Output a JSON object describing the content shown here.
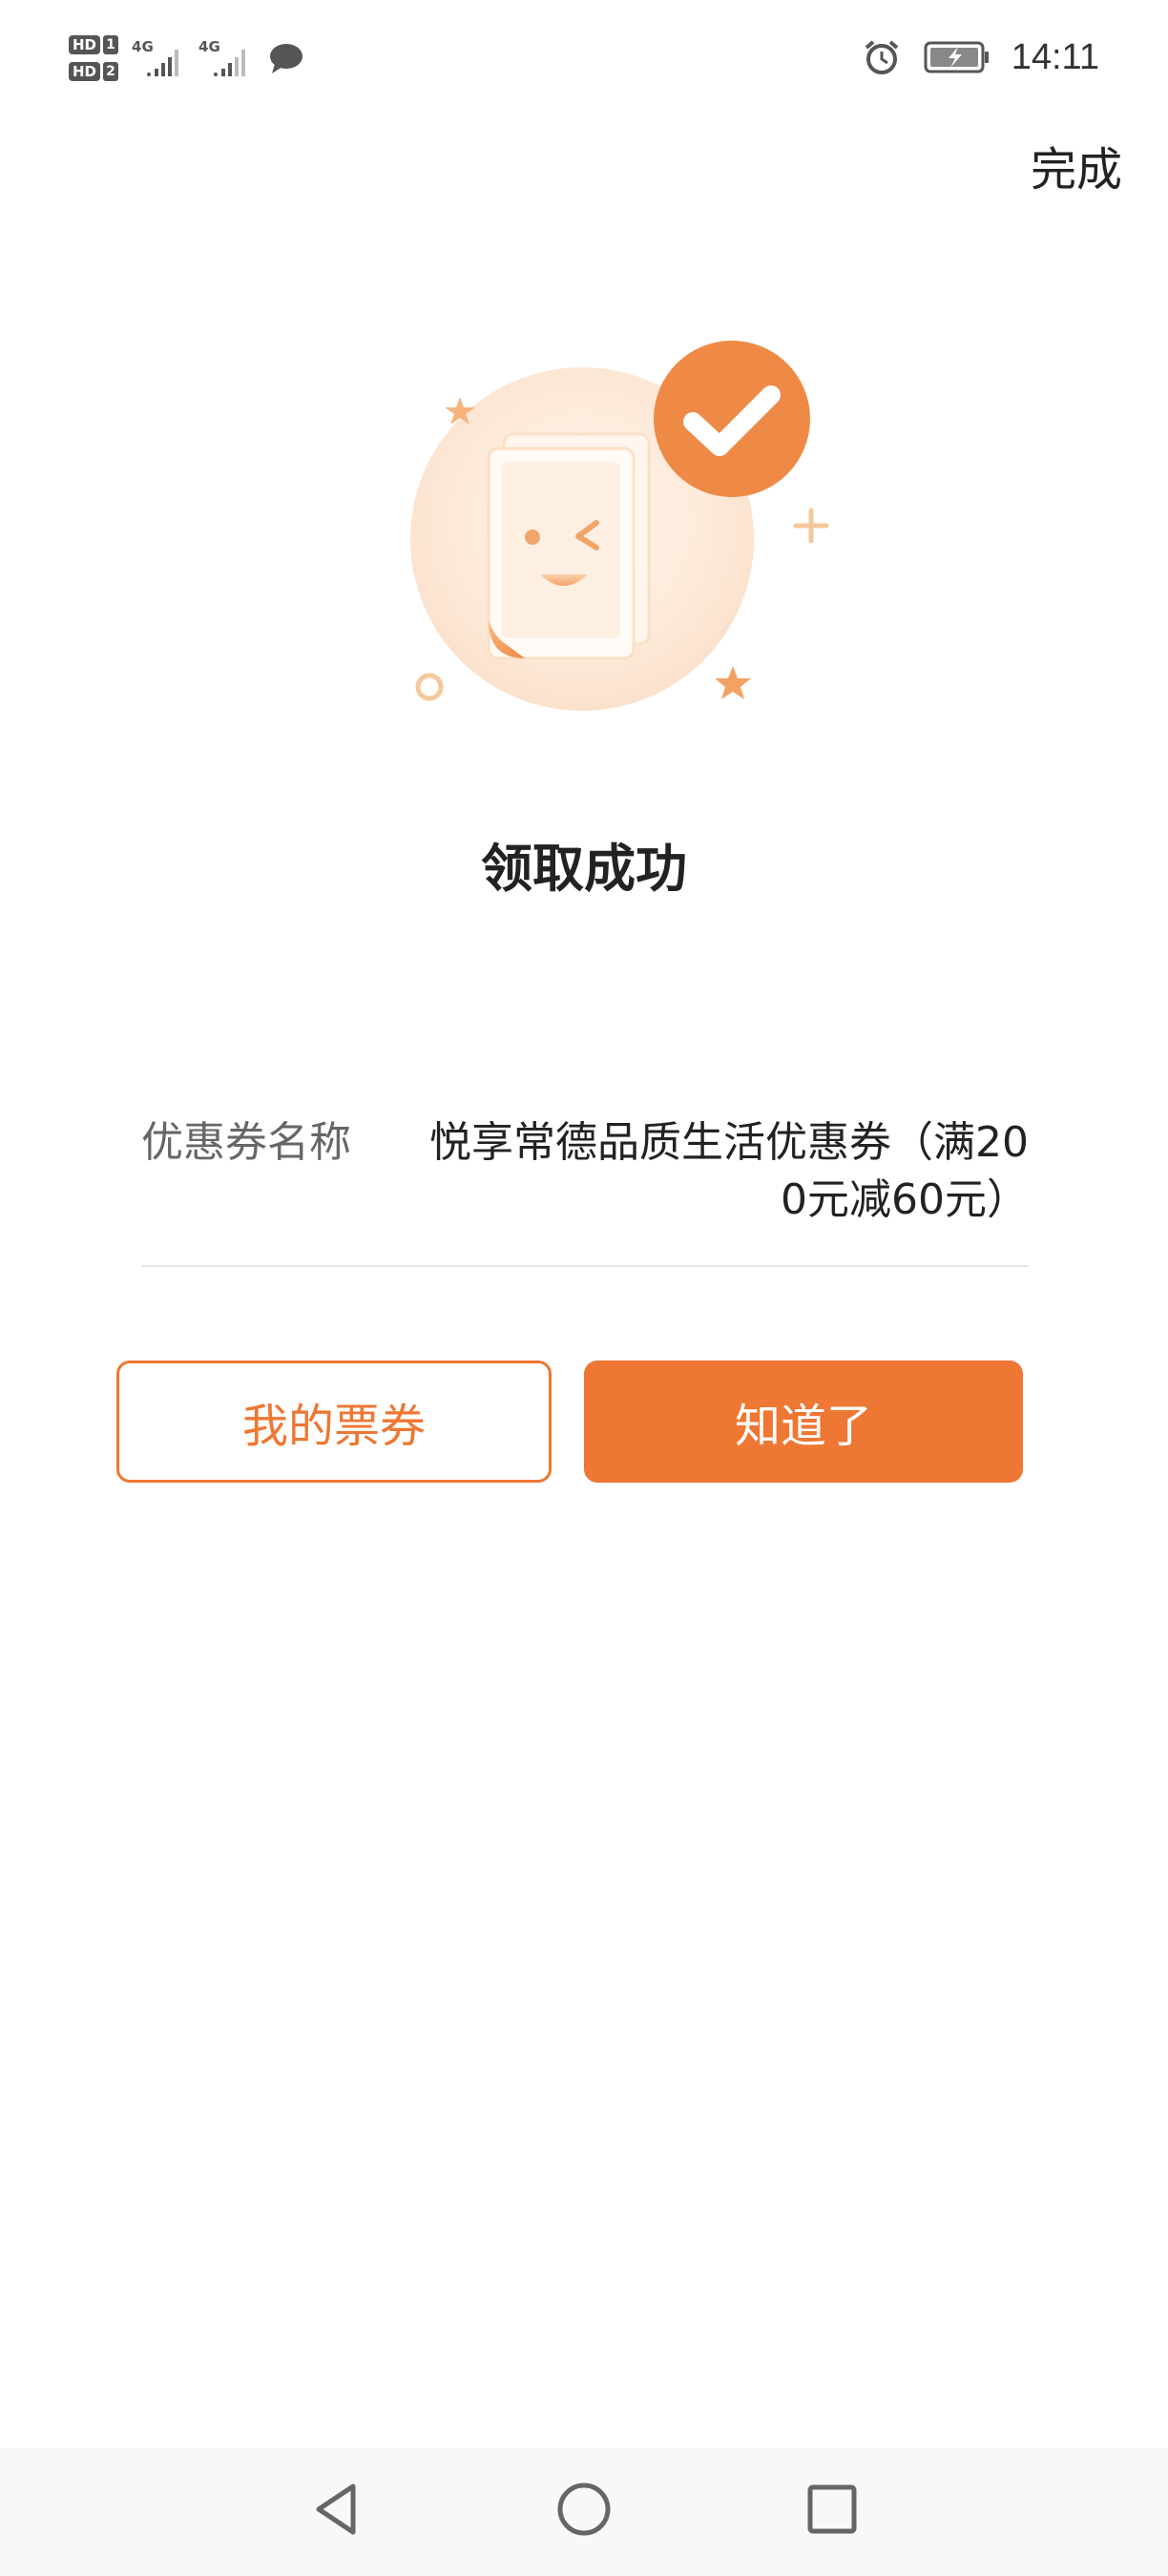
{
  "status_bar": {
    "sim1_badge": "HD",
    "sim1_slot": "1",
    "sim2_badge": "HD",
    "sim2_slot": "2",
    "network1": "4G",
    "network2": "4G",
    "time": "14:11",
    "icons": [
      "signal-icon",
      "chat-icon",
      "alarm-icon",
      "battery-charging-icon"
    ]
  },
  "header": {
    "done_label": "完成"
  },
  "illustration": {
    "icon": "coupon-success-illustration",
    "accent_color": "#ee7733"
  },
  "result": {
    "title": "领取成功"
  },
  "coupon": {
    "label": "优惠券名称",
    "value": "悦享常德品质生活优惠券（满200元减60元）"
  },
  "buttons": {
    "my_tickets_label": "我的票券",
    "ok_label": "知道了"
  },
  "nav": {
    "icons": [
      "back-icon",
      "home-icon",
      "recents-icon"
    ]
  },
  "colors": {
    "accent": "#ee7733",
    "text_primary": "#222222",
    "text_secondary": "#666666",
    "divider": "#e6e6e6"
  }
}
